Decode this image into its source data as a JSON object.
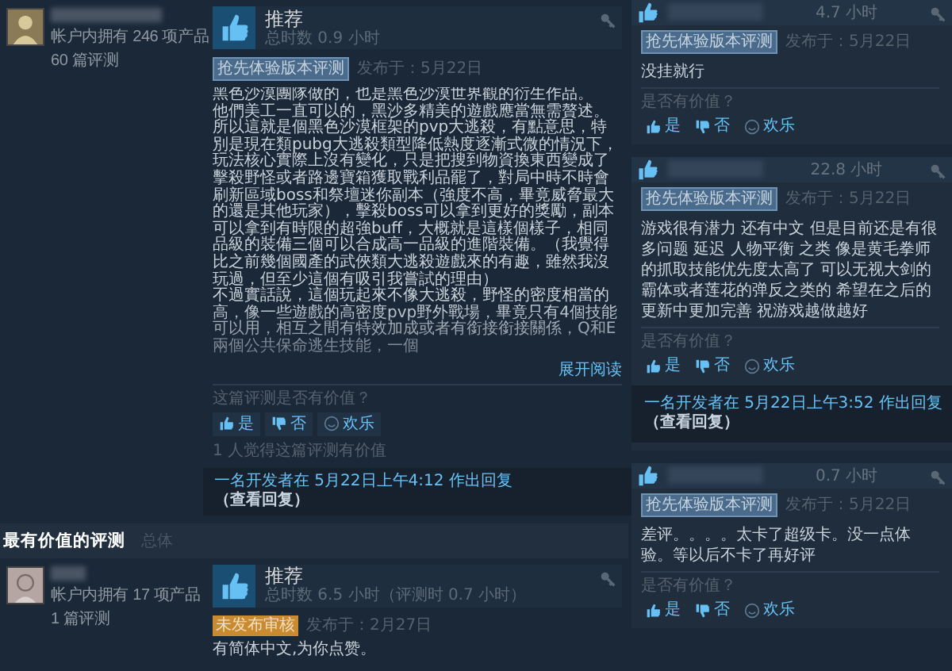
{
  "reviews": [
    {
      "author": {
        "products": "帐户内拥有 246 项产品",
        "reviews": "60 篇评测"
      },
      "verdict": "推荐",
      "recommended": true,
      "hours": "总时数 0.9 小时",
      "badge": {
        "kind": "early_access",
        "text": "抢先体验版本评测"
      },
      "posted": "发布于：5月22日",
      "paragraphs": [
        "黑色沙漠團隊做的，也是黑色沙漠世界觀的衍生作品。",
        "他們美工一直可以的，黑沙多精美的遊戲應當無需贅述。所以這就是個黑色沙漠框架的pvp大逃殺，有點意思，特別是現在類pubg大逃殺類型降低熱度逐漸式微的情況下，玩法核心實際上沒有變化，只是把搜到物資換東西變成了擊殺野怪或者路邊寶箱獲取戰利品罷了，對局中時不時會刷新區域boss和祭壇迷你副本（強度不高，畢竟威脅最大的還是其他玩家），擊殺boss可以拿到更好的獎勵，副本可以拿到有時限的超強buff，大概就是這樣個樣子，相同品級的裝備三個可以合成高一品級的進階裝備。（我覺得比之前幾個國產的武俠類大逃殺遊戲來的有趣，雖然我沒玩過，但至少這個有吸引我嘗試的理由）",
        "不過實話說，這個玩起來不像大逃殺，野怪的密度相當的高，像一些遊戲的高密度pvp野外戰場，畢竟只有4個技能可以用，相互之間有特效加成或者有銜接銜接關係，Q和E兩個公共保命逃生技能，一個"
      ],
      "expand": "展开阅读",
      "helpful_prompt": "这篇评测是否有价值？",
      "votes": [
        {
          "kind": "yes",
          "label": "是"
        },
        {
          "kind": "no",
          "label": "否"
        },
        {
          "kind": "funny",
          "label": "欢乐"
        }
      ],
      "helpful_count": "1 人觉得这篇评测有价值",
      "developer_reply": {
        "text": "一名开发者在 5月22日上午4:12 作出回复",
        "link": "（查看回复）"
      }
    }
  ],
  "most_helpful": {
    "title": "最有价值的评测",
    "filter": "总体",
    "reviews": [
      {
        "author": {
          "products": "帐户内拥有 17 项产品",
          "reviews": "1 篇评测"
        },
        "verdict": "推荐",
        "recommended": true,
        "hours": "总时数 6.5 小时（评测时 0.7 小时）",
        "badge": {
          "kind": "other",
          "text": "未发布审核"
        },
        "posted": "发布于：2月27日",
        "paragraphs": [
          "有简体中文,为你点赞。"
        ]
      }
    ]
  },
  "side_reviews": [
    {
      "recommended": true,
      "hours": "4.7 小时",
      "badge": {
        "kind": "early_access",
        "text": "抢先体验版本评测"
      },
      "posted": "发布于：5月22日",
      "text": "没挂就行",
      "helpful_prompt": "是否有价值？",
      "votes": [
        {
          "kind": "yes",
          "label": "是"
        },
        {
          "kind": "no",
          "label": "否"
        },
        {
          "kind": "funny",
          "label": "欢乐"
        }
      ]
    },
    {
      "recommended": true,
      "hours": "22.8 小时",
      "badge": {
        "kind": "early_access",
        "text": "抢先体验版本评测"
      },
      "posted": "发布于：5月22日",
      "text": "游戏很有潜力 还有中文 但是目前还是有很多问题 延迟 人物平衡 之类 像是黄毛拳师的抓取技能优先度太高了 可以无视大剑的霸体或者莲花的弹反之类的 希望在之后的更新中更加完善 祝游戏越做越好",
      "helpful_prompt": "是否有价值？",
      "votes": [
        {
          "kind": "yes",
          "label": "是"
        },
        {
          "kind": "no",
          "label": "否"
        },
        {
          "kind": "funny",
          "label": "欢乐"
        }
      ],
      "developer_reply": {
        "text": "一名开发者在 5月22日上午3:52 作出回复",
        "link": "（查看回复）"
      }
    },
    {
      "recommended": true,
      "hours": "0.7 小时",
      "badge": {
        "kind": "early_access",
        "text": "抢先体验版本评测"
      },
      "posted": "发布于：5月22日",
      "text": "差评。。。。太卡了超级卡。没一点体验。等以后不卡了再好评",
      "helpful_prompt": "是否有价值？",
      "votes": [
        {
          "kind": "yes",
          "label": "是"
        },
        {
          "kind": "no",
          "label": "否"
        },
        {
          "kind": "funny",
          "label": "欢乐"
        }
      ]
    }
  ]
}
